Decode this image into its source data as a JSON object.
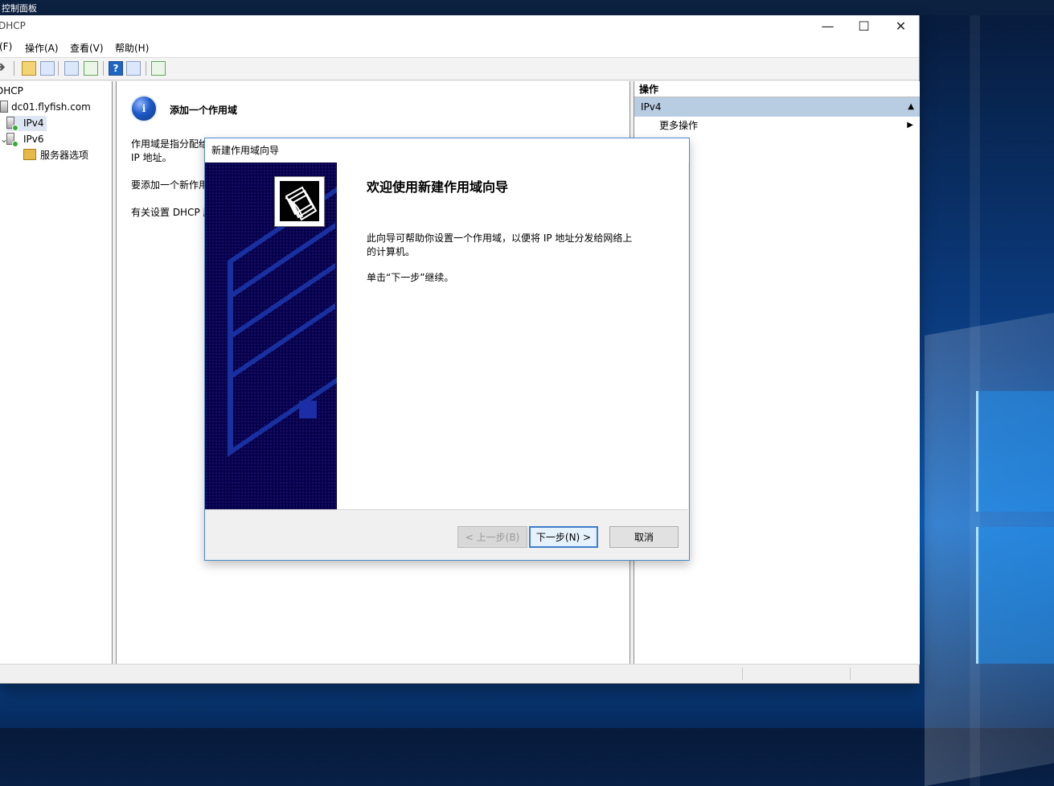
{
  "desktop": {
    "top_label": "控制面板"
  },
  "window": {
    "title": "DHCP",
    "minimize_symbol": "—",
    "maximize_symbol": "☐",
    "close_symbol": "✕"
  },
  "menu": {
    "items": [
      "(F)",
      "操作(A)",
      "查看(V)",
      "帮助(H)"
    ]
  },
  "toolbar": {
    "icons": [
      "forward-icon",
      "folder-up-icon",
      "show-hide-console-tree-icon",
      "properties-icon",
      "refresh-icon",
      "help-icon",
      "show-action-pane-icon",
      "monitor-icon"
    ]
  },
  "tree": {
    "root": "DHCP",
    "server": "dc01.flyfish.com",
    "ipv4": "IPv4",
    "ipv6": "IPv6",
    "server_options": "服务器选项"
  },
  "content": {
    "title": "添加一个作用域",
    "line1": "作用域是指分配给",
    "line2": "IP 地址。",
    "line3": "要添加一个新作用",
    "line4": "有关设置 DHCP 服"
  },
  "actions": {
    "header": "操作",
    "section": "IPv4",
    "more": "更多操作"
  },
  "wizard": {
    "title": "新建作用域向导",
    "heading": "欢迎使用新建作用域向导",
    "description_line1": "此向导可帮助你设置一个作用域，以便将 IP 地址分发给网络上",
    "description_line2": "的计算机。",
    "continue": "单击“下一步”继续。",
    "back": "< 上一步(B)",
    "next": "下一步(N) >",
    "cancel": "取消"
  }
}
